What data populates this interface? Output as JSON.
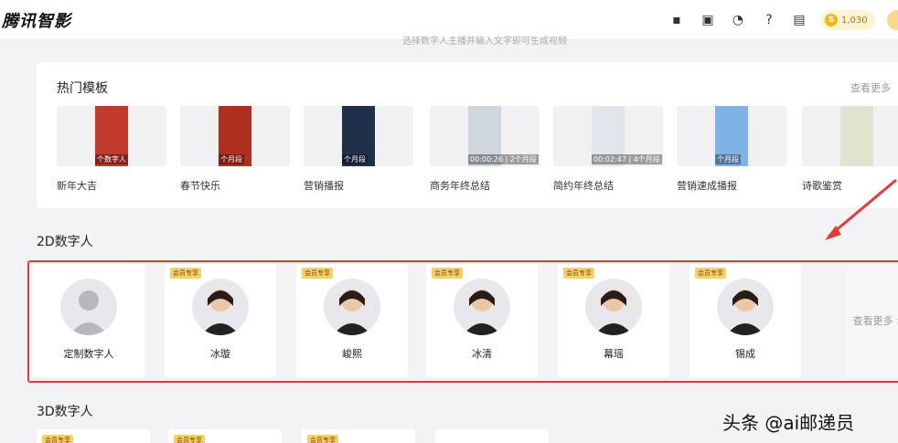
{
  "app": {
    "logo": "腾讯智影",
    "hint": "选择数字人主播并输入文字即可生成视频",
    "coins": "1,030"
  },
  "topbar_icons": [
    "monitor-icon",
    "clipboard-icon",
    "headset-icon",
    "help-icon",
    "message-icon"
  ],
  "templates": {
    "title": "热门模板",
    "more": "查看更多",
    "items": [
      {
        "name": "新年大吉",
        "tag": "个数字人",
        "color": "#c0392b"
      },
      {
        "name": "春节快乐",
        "tag": "个月段",
        "color": "#b03020"
      },
      {
        "name": "营销播报",
        "tag": "个月段",
        "color": "#20304a"
      },
      {
        "name": "商务年终总结",
        "tag": "00:00:26 | 2个月段",
        "color": "#cfd6de"
      },
      {
        "name": "简约年终总结",
        "tag": "00:02:47 | 4个月段",
        "color": "#e0e6ea"
      },
      {
        "name": "营销速成播报",
        "tag": "个月段",
        "color": "#7fb3e6"
      },
      {
        "name": "诗歌鉴赏",
        "tag": "",
        "color": "#dfe3d0"
      }
    ]
  },
  "digital_2d": {
    "title": "2D数字人",
    "badge": "会员专享",
    "more": "查看更多 >",
    "items": [
      {
        "name": "定制数字人",
        "member": false
      },
      {
        "name": "冰璇",
        "member": true
      },
      {
        "name": "峻熙",
        "member": true
      },
      {
        "name": "冰清",
        "member": true
      },
      {
        "name": "幕瑶",
        "member": true
      },
      {
        "name": "锡成",
        "member": true
      }
    ]
  },
  "digital_3d": {
    "title": "3D数字人",
    "badge": "会员专享"
  },
  "watermark": "头条 @ai邮递员"
}
